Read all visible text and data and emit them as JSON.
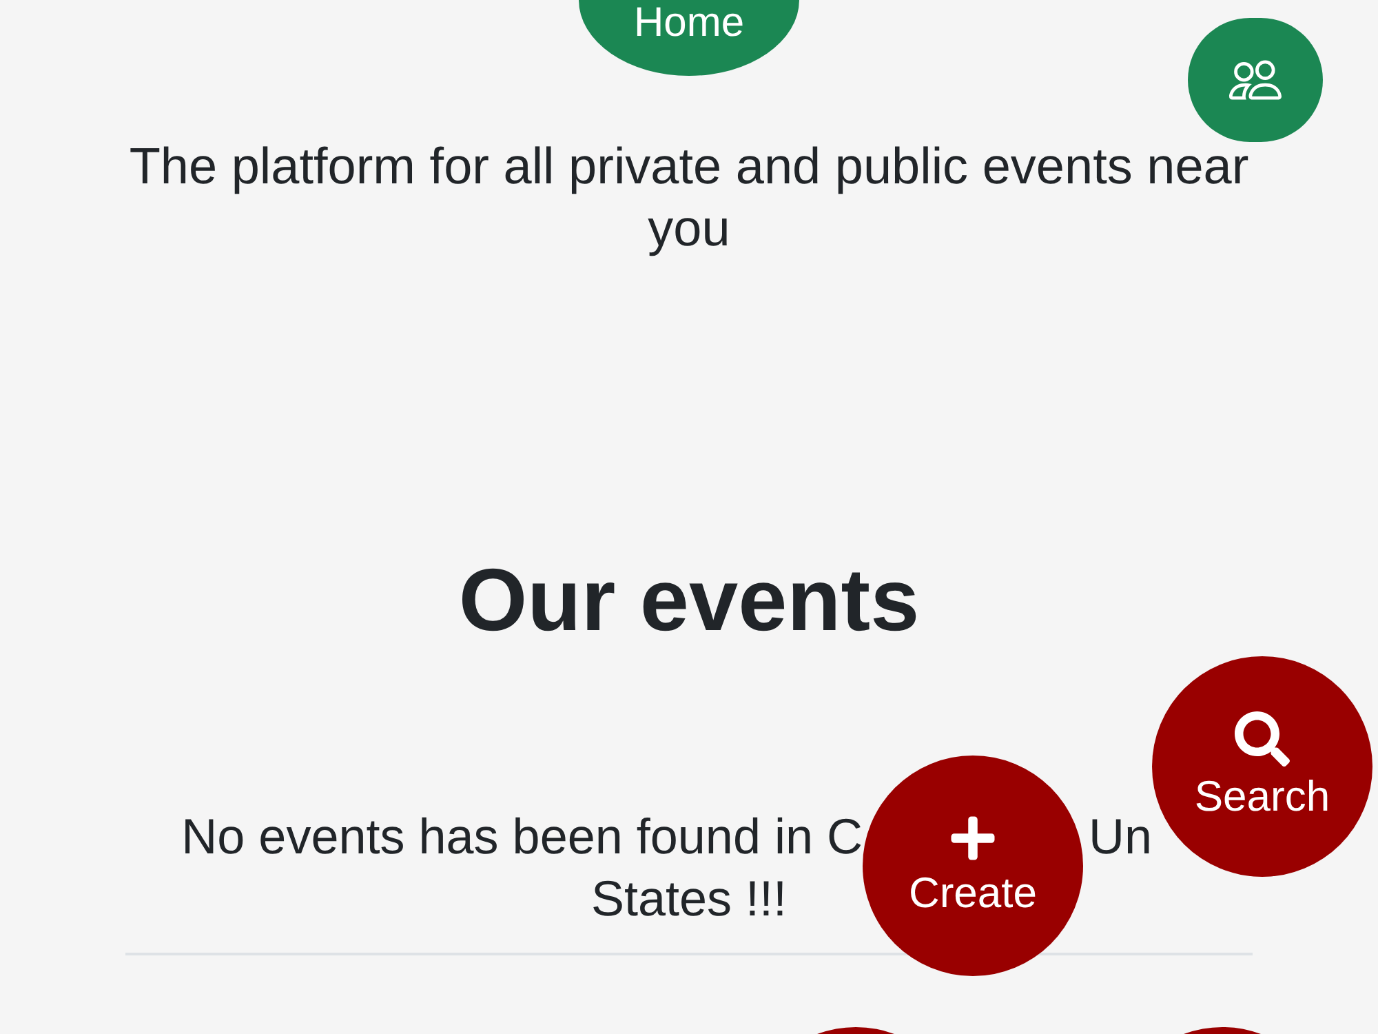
{
  "home_button": {
    "label": "Home"
  },
  "tagline": "The platform for all private and public events near you",
  "events_section": {
    "title": "Our events",
    "message_line_1_start": "No events has been found in C",
    "message_line_1_end": "Un",
    "message_line_2": "States !!!"
  },
  "actions": [
    {
      "kind": "create",
      "label": "Create"
    },
    {
      "kind": "search",
      "label": "Search"
    }
  ]
}
